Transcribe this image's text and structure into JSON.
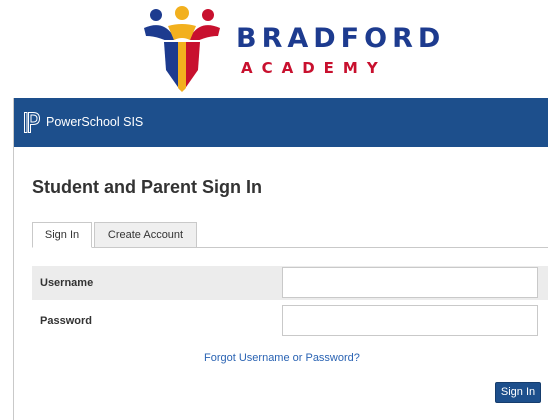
{
  "school": {
    "name": "BRADFORD",
    "subtitle": "ACADEMY"
  },
  "header": {
    "app_name": "PowerSchool SIS"
  },
  "page": {
    "title": "Student and Parent Sign In"
  },
  "tabs": [
    {
      "label": "Sign In",
      "active": true
    },
    {
      "label": "Create Account",
      "active": false
    }
  ],
  "form": {
    "username_label": "Username",
    "username_value": "",
    "password_label": "Password",
    "password_value": "",
    "forgot_link": "Forgot Username or Password?",
    "submit_label": "Sign In"
  },
  "colors": {
    "header_bg": "#1d4f8c",
    "brand_blue": "#1d3b8f",
    "brand_red": "#c8102e",
    "brand_gold": "#f2b01e",
    "link": "#2a63b3"
  },
  "icons": {
    "school_logo": "bradford-crest-icon",
    "app_logo": "powerschool-p-icon"
  }
}
